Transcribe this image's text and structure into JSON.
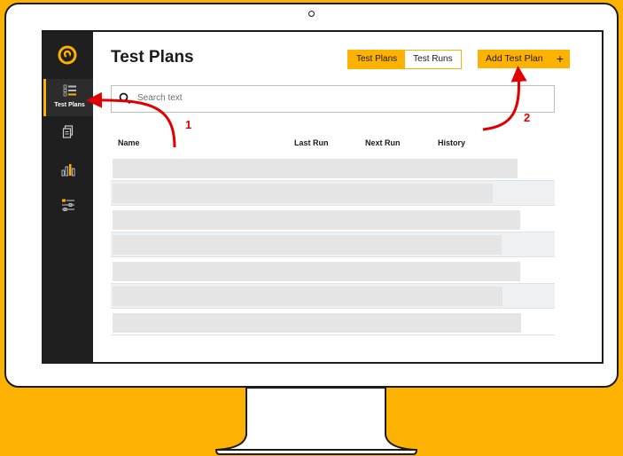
{
  "app": {
    "page_title": "Test Plans",
    "colors": {
      "accent": "#FDB100",
      "sidebar": "#1f1f1f",
      "annotation": "#e00000"
    }
  },
  "sidebar": {
    "items": [
      {
        "label": "Test Plans",
        "icon": "test-plans-icon",
        "active": true
      },
      {
        "label": "",
        "icon": "document-icon"
      },
      {
        "label": "",
        "icon": "chart-icon"
      },
      {
        "label": "",
        "icon": "settings-sliders-icon"
      }
    ]
  },
  "header": {
    "tabs": [
      {
        "label": "Test Plans",
        "selected": true
      },
      {
        "label": "Test Runs",
        "selected": false
      }
    ],
    "add_button_label": "Add Test Plan",
    "add_button_icon": "+"
  },
  "search": {
    "placeholder": "Search text"
  },
  "table": {
    "columns": [
      "Name",
      "Last Run",
      "Next Run",
      "History"
    ],
    "row_count": 7
  },
  "annotations": {
    "marker_1": "1",
    "marker_2": "2"
  }
}
